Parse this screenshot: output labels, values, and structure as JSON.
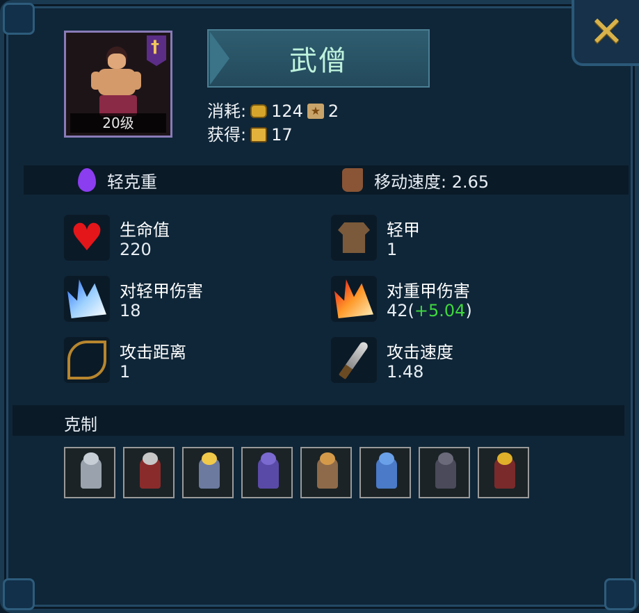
{
  "unit": {
    "name": "武僧",
    "level_label": "20级"
  },
  "cost": {
    "consume_label": "消耗:",
    "gold": "124",
    "star": "2",
    "gain_label": "获得:",
    "gain": "17"
  },
  "traits": {
    "counter_type": "轻克重",
    "move_speed": "移动速度: 2.65"
  },
  "stats": {
    "hp": {
      "label": "生命值",
      "value": "220",
      "icon": "heart-icon"
    },
    "armor": {
      "label": "轻甲",
      "value": "1",
      "icon": "shirt-icon"
    },
    "dmg_light": {
      "label": "对轻甲伤害",
      "value": "18",
      "icon": "blue-flame-icon"
    },
    "dmg_heavy": {
      "label": "对重甲伤害",
      "value": "42(",
      "bonus": "+5.04",
      "close": ")",
      "icon": "red-flame-icon"
    },
    "range": {
      "label": "攻击距离",
      "value": "1",
      "icon": "bow-icon"
    },
    "atk_speed": {
      "label": "攻击速度",
      "value": "1.48",
      "icon": "knife-icon"
    }
  },
  "counters": {
    "title": "克制",
    "units": [
      {
        "name": "spear-knight",
        "color": "#9aa3ad",
        "head": "#c8ced6"
      },
      {
        "name": "red-plume-knight",
        "color": "#8a2b2b",
        "head": "#c7c7c7"
      },
      {
        "name": "blonde-warrior",
        "color": "#6c7aa0",
        "head": "#f0c84a"
      },
      {
        "name": "purple-crossbowman",
        "color": "#5a4aa8",
        "head": "#7b6ad0"
      },
      {
        "name": "horned-warrior",
        "color": "#8e6a4a",
        "head": "#d49a4a"
      },
      {
        "name": "blue-dragon",
        "color": "#4a7ac8",
        "head": "#6aa0e8"
      },
      {
        "name": "dark-knight",
        "color": "#4a4a5a",
        "head": "#6a6a7a"
      },
      {
        "name": "samurai",
        "color": "#7a2a2a",
        "head": "#e0b02a"
      }
    ]
  },
  "colors": {
    "bonus": "#3fd83f",
    "title": "#bff2dc",
    "close": "#d8b24a"
  }
}
